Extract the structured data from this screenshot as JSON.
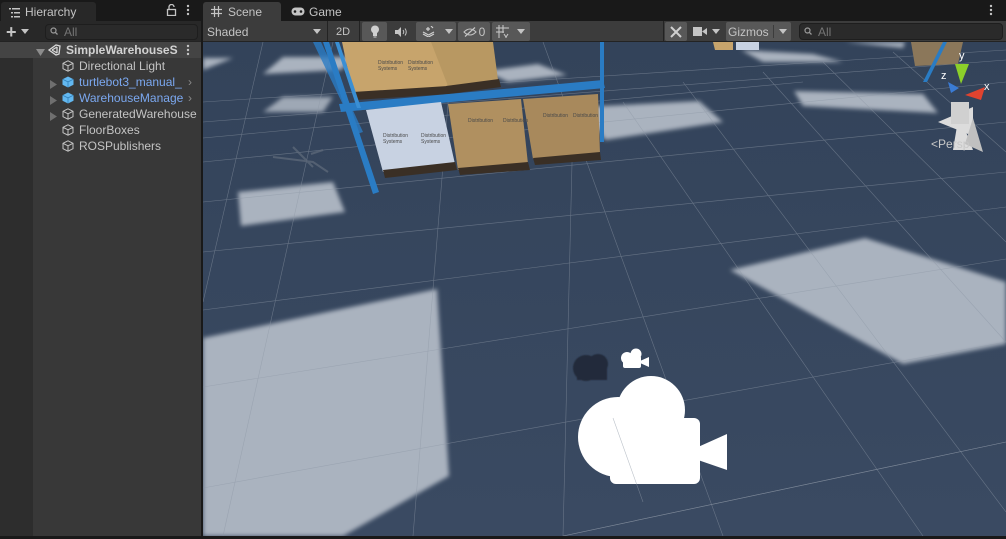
{
  "hierarchy": {
    "tab_label": "Hierarchy",
    "search_placeholder": "All",
    "add_label": "+",
    "items": [
      {
        "label": "SimpleWarehouseS",
        "type": "scene",
        "expanded": true
      },
      {
        "label": "Directional Light",
        "type": "gameobject"
      },
      {
        "label": "turtlebot3_manual_",
        "type": "prefab",
        "has_children": true
      },
      {
        "label": "WarehouseManage",
        "type": "prefab",
        "has_children": true
      },
      {
        "label": "GeneratedWarehouse",
        "type": "gameobject",
        "has_children": true
      },
      {
        "label": "FloorBoxes",
        "type": "gameobject"
      },
      {
        "label": "ROSPublishers",
        "type": "gameobject"
      }
    ]
  },
  "scene": {
    "tabs": [
      {
        "label": "Scene",
        "icon": "grid-icon",
        "active": true
      },
      {
        "label": "Game",
        "icon": "gamepad-icon",
        "active": false
      }
    ],
    "toolbar": {
      "draw_mode": "Shaded",
      "mode_2d": "2D",
      "hidden_count": "0",
      "gizmos_label": "Gizmos",
      "search_placeholder": "All"
    },
    "gizmo": {
      "x_label": "x",
      "y_label": "y",
      "z_label": "z",
      "projection": "Persp",
      "x_color": "#e0432f",
      "y_color": "#8ccf2a",
      "z_color": "#3a7bd5"
    },
    "boxes_text": "Distribution Systems"
  },
  "colors": {
    "floor": "#36465e",
    "light_patch": "#aab3bf",
    "rack": "#2a7cc4",
    "box_tan": "#c7a46c",
    "box_white": "#c8d2e2"
  }
}
